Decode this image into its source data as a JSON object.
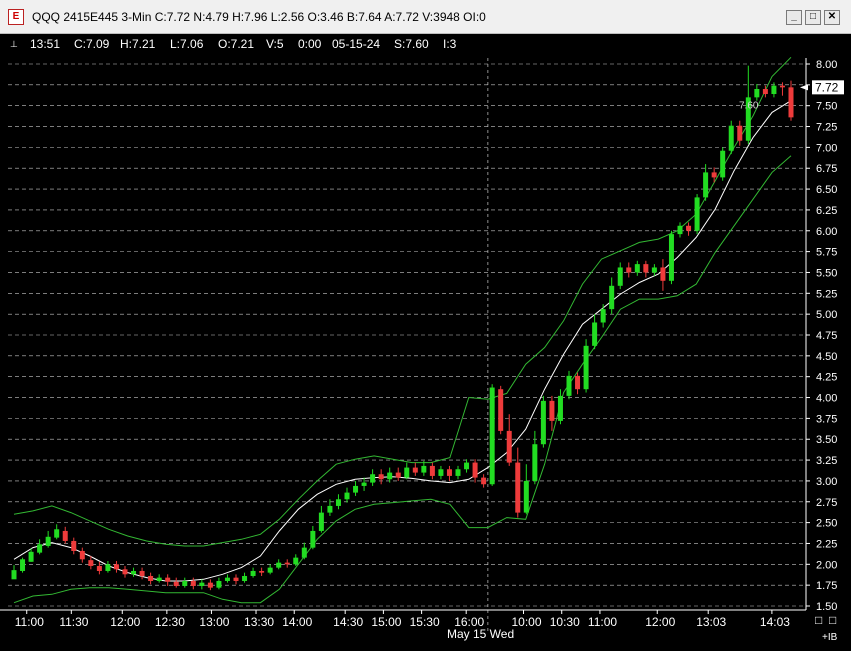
{
  "window": {
    "title": "QQQ 2415E445 3-Min C:7.72 N:4.79 H:7.96 L:2.56 O:3.46 B:7.64 A:7.72 V:3948 OI:0",
    "app_icon_glyph": "E",
    "minimize_glyph": "_",
    "maximize_glyph": "□",
    "close_glyph": "✕"
  },
  "info_bar": {
    "pin_glyph": "⊥",
    "items": [
      "13:51",
      "C:7.09",
      "H:7.21",
      "L:7.06",
      "O:7.21",
      "V:5",
      "0:00",
      "05-15-24",
      "S:7.60",
      "I:3"
    ]
  },
  "chart_footer": {
    "date_label": "May 15 Wed",
    "ib_label": "+IB",
    "box_glyphs": [
      "□",
      "□"
    ]
  },
  "colors": {
    "up": "#22dd22",
    "down": "#ee3b3b",
    "band": "#33b833",
    "average": "#ffffff",
    "grid": "#c8c8c8",
    "background": "#000000",
    "price_box_bg": "#ffffff"
  },
  "chart_data": {
    "type": "candlestick",
    "title": "QQQ 2415E445 3-Min",
    "ylim": [
      1.5,
      8.0
    ],
    "y_ticks": [
      "8.00",
      "7.75",
      "7.50",
      "7.25",
      "7.00",
      "6.75",
      "6.50",
      "6.25",
      "6.00",
      "5.75",
      "5.50",
      "5.25",
      "5.00",
      "4.75",
      "4.50",
      "4.25",
      "4.00",
      "3.75",
      "3.50",
      "3.25",
      "3.00",
      "2.75",
      "2.50",
      "2.25",
      "2.00",
      "1.75",
      "1.50"
    ],
    "x_tick_labels": [
      "11:00",
      "11:30",
      "12:00",
      "12:30",
      "13:00",
      "13:30",
      "14:00",
      "14:30",
      "15:00",
      "15:30",
      "16:00",
      "10:00",
      "10:30",
      "11:00",
      "12:00",
      "13:03",
      "14:03"
    ],
    "session_break_label": "May 15 Wed",
    "last_price": "7.72",
    "marker_label": "7.60",
    "bollinger": {
      "upper": [
        2.6,
        2.64,
        2.7,
        2.62,
        2.52,
        2.42,
        2.34,
        2.28,
        2.24,
        2.22,
        2.22,
        2.26,
        2.3,
        2.36,
        2.54,
        2.78,
        3.0,
        3.2,
        3.26,
        3.3,
        3.26,
        3.22,
        3.22,
        3.28,
        4.0,
        3.98,
        4.05,
        4.4,
        4.6,
        4.92,
        5.36,
        5.66,
        5.76,
        5.86,
        5.9,
        6.0,
        6.2,
        6.6,
        7.0,
        7.38,
        7.85,
        8.08
      ],
      "middle": [
        2.06,
        2.2,
        2.26,
        2.2,
        2.1,
        1.98,
        1.9,
        1.84,
        1.8,
        1.8,
        1.82,
        1.88,
        1.96,
        2.1,
        2.4,
        2.66,
        2.84,
        2.96,
        3.02,
        3.04,
        3.05,
        3.03,
        3.0,
        2.98,
        3.02,
        3.16,
        3.34,
        3.62,
        4.1,
        4.52,
        4.88,
        5.06,
        5.24,
        5.38,
        5.48,
        5.68,
        5.92,
        6.26,
        6.72,
        7.12,
        7.42,
        7.56
      ],
      "lower": [
        1.54,
        1.62,
        1.64,
        1.7,
        1.72,
        1.72,
        1.7,
        1.68,
        1.66,
        1.66,
        1.66,
        1.58,
        1.54,
        1.54,
        1.7,
        2.0,
        2.3,
        2.52,
        2.66,
        2.72,
        2.74,
        2.76,
        2.78,
        2.72,
        2.44,
        2.44,
        2.56,
        2.54,
        3.2,
        4.06,
        4.4,
        4.72,
        5.06,
        5.18,
        5.18,
        5.22,
        5.36,
        5.74,
        6.06,
        6.38,
        6.7,
        6.9
      ]
    },
    "candles": [
      [
        1.82,
        1.93,
        1.84,
        1.99
      ],
      [
        1.92,
        2.06,
        1.9,
        2.08
      ],
      [
        2.03,
        2.15,
        2.03,
        2.19
      ],
      [
        2.14,
        2.24,
        2.12,
        2.3
      ],
      [
        2.22,
        2.33,
        2.2,
        2.4
      ],
      [
        2.32,
        2.42,
        2.3,
        2.48
      ],
      [
        2.4,
        2.28,
        2.25,
        2.45
      ],
      [
        2.28,
        2.16,
        2.12,
        2.32
      ],
      [
        2.16,
        2.06,
        2.02,
        2.2
      ],
      [
        2.05,
        1.98,
        1.94,
        2.1
      ],
      [
        1.98,
        1.92,
        1.88,
        2.03
      ],
      [
        1.92,
        2.0,
        1.9,
        2.04
      ],
      [
        2.0,
        1.94,
        1.9,
        2.04
      ],
      [
        1.94,
        1.88,
        1.84,
        1.98
      ],
      [
        1.88,
        1.92,
        1.85,
        1.96
      ],
      [
        1.92,
        1.86,
        1.82,
        1.96
      ],
      [
        1.86,
        1.8,
        1.76,
        1.9
      ],
      [
        1.8,
        1.84,
        1.78,
        1.88
      ],
      [
        1.84,
        1.79,
        1.74,
        1.88
      ],
      [
        1.79,
        1.74,
        1.72,
        1.84
      ],
      [
        1.74,
        1.8,
        1.72,
        1.84
      ],
      [
        1.8,
        1.74,
        1.7,
        1.84
      ],
      [
        1.74,
        1.78,
        1.7,
        1.82
      ],
      [
        1.78,
        1.72,
        1.69,
        1.82
      ],
      [
        1.72,
        1.8,
        1.7,
        1.84
      ],
      [
        1.8,
        1.84,
        1.78,
        1.88
      ],
      [
        1.84,
        1.8,
        1.76,
        1.88
      ],
      [
        1.8,
        1.86,
        1.78,
        1.9
      ],
      [
        1.86,
        1.92,
        1.84,
        1.96
      ],
      [
        1.92,
        1.9,
        1.86,
        1.96
      ],
      [
        1.9,
        1.96,
        1.88,
        2.0
      ],
      [
        1.96,
        2.02,
        1.94,
        2.06
      ],
      [
        2.02,
        2.0,
        1.96,
        2.06
      ],
      [
        2.0,
        2.08,
        1.98,
        2.12
      ],
      [
        2.08,
        2.2,
        2.06,
        2.26
      ],
      [
        2.2,
        2.4,
        2.18,
        2.46
      ],
      [
        2.4,
        2.62,
        2.38,
        2.7
      ],
      [
        2.62,
        2.7,
        2.58,
        2.78
      ],
      [
        2.7,
        2.78,
        2.66,
        2.84
      ],
      [
        2.78,
        2.86,
        2.74,
        2.92
      ],
      [
        2.86,
        2.94,
        2.82,
        3.0
      ],
      [
        2.94,
        2.98,
        2.88,
        3.04
      ],
      [
        2.98,
        3.08,
        2.94,
        3.14
      ],
      [
        3.08,
        3.02,
        2.96,
        3.14
      ],
      [
        3.02,
        3.1,
        2.98,
        3.16
      ],
      [
        3.1,
        3.04,
        3.0,
        3.16
      ],
      [
        3.04,
        3.16,
        3.02,
        3.22
      ],
      [
        3.16,
        3.1,
        3.06,
        3.22
      ],
      [
        3.1,
        3.18,
        3.06,
        3.24
      ],
      [
        3.18,
        3.06,
        3.02,
        3.22
      ],
      [
        3.06,
        3.14,
        3.02,
        3.18
      ],
      [
        3.14,
        3.06,
        3.0,
        3.18
      ],
      [
        3.06,
        3.14,
        3.02,
        3.18
      ],
      [
        3.14,
        3.22,
        3.1,
        3.26
      ],
      [
        3.22,
        3.04,
        2.98,
        3.26
      ],
      [
        3.04,
        2.96,
        2.92,
        3.08
      ],
      [
        2.96,
        4.12,
        2.94,
        4.16
      ],
      [
        4.1,
        3.6,
        3.56,
        4.14
      ],
      [
        3.6,
        3.22,
        3.18,
        3.8
      ],
      [
        3.22,
        2.62,
        2.56,
        3.4
      ],
      [
        2.62,
        3.0,
        2.6,
        3.2
      ],
      [
        3.0,
        3.44,
        2.96,
        3.6
      ],
      [
        3.44,
        3.96,
        3.4,
        4.02
      ],
      [
        3.96,
        3.72,
        3.6,
        4.02
      ],
      [
        3.72,
        4.02,
        3.68,
        4.1
      ],
      [
        4.02,
        4.26,
        3.98,
        4.32
      ],
      [
        4.26,
        4.1,
        4.04,
        4.3
      ],
      [
        4.1,
        4.62,
        4.06,
        4.7
      ],
      [
        4.62,
        4.9,
        4.58,
        5.0
      ],
      [
        4.9,
        5.06,
        4.84,
        5.12
      ],
      [
        5.06,
        5.34,
        5.0,
        5.44
      ],
      [
        5.34,
        5.56,
        5.3,
        5.62
      ],
      [
        5.56,
        5.5,
        5.44,
        5.62
      ],
      [
        5.5,
        5.6,
        5.46,
        5.64
      ],
      [
        5.6,
        5.5,
        5.44,
        5.64
      ],
      [
        5.5,
        5.56,
        5.46,
        5.6
      ],
      [
        5.56,
        5.4,
        5.28,
        5.66
      ],
      [
        5.4,
        5.96,
        5.36,
        6.0
      ],
      [
        5.96,
        6.06,
        5.92,
        6.1
      ],
      [
        6.06,
        6.0,
        5.94,
        6.1
      ],
      [
        6.0,
        6.4,
        5.96,
        6.44
      ],
      [
        6.4,
        6.7,
        6.36,
        6.8
      ],
      [
        6.7,
        6.64,
        6.58,
        6.76
      ],
      [
        6.64,
        6.96,
        6.6,
        7.0
      ],
      [
        6.96,
        7.26,
        6.92,
        7.32
      ],
      [
        7.26,
        7.08,
        7.02,
        7.32
      ],
      [
        7.08,
        7.6,
        7.04,
        7.98
      ],
      [
        7.6,
        7.7,
        7.56,
        7.76
      ],
      [
        7.7,
        7.64,
        7.6,
        7.74
      ],
      [
        7.64,
        7.74,
        7.6,
        7.78
      ],
      [
        7.74,
        7.72,
        7.62,
        7.78
      ],
      [
        7.72,
        7.36,
        7.32,
        7.8
      ]
    ]
  }
}
